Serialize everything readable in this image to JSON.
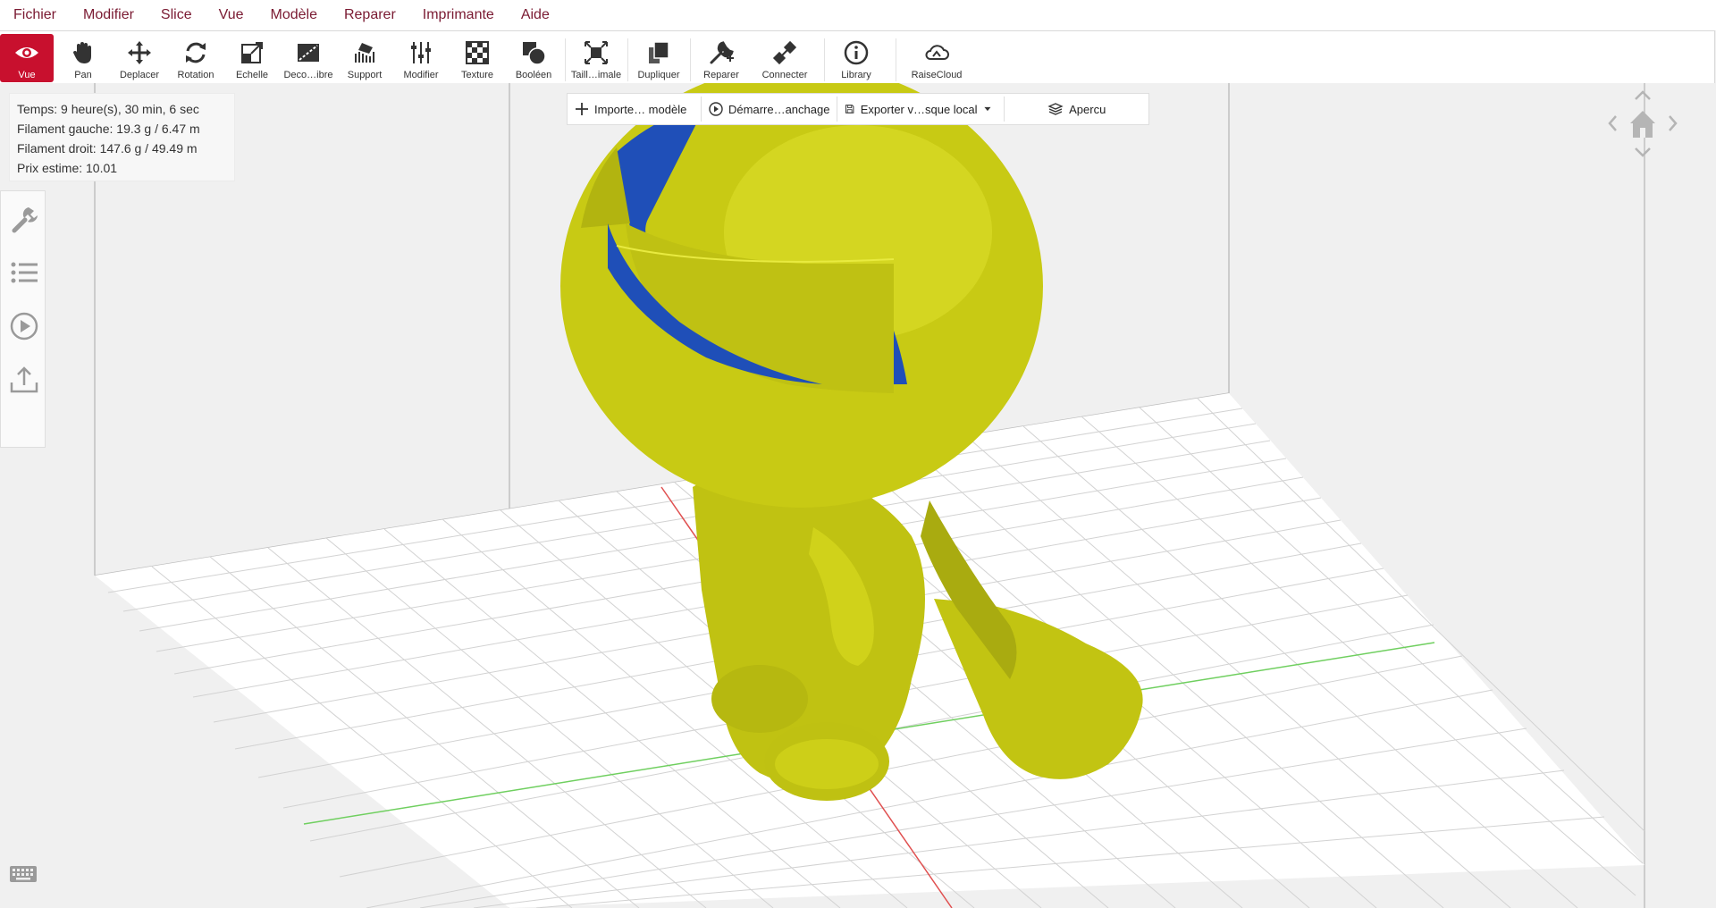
{
  "menu": [
    "Fichier",
    "Modifier",
    "Slice",
    "Vue",
    "Modèle",
    "Reparer",
    "Imprimante",
    "Aide"
  ],
  "toolbar": {
    "vue": "Vue",
    "pan": "Pan",
    "deplacer": "Deplacer",
    "rotation": "Rotation",
    "echelle": "Echelle",
    "decoupe": "Deco…ibre",
    "support": "Support",
    "modifier": "Modifier",
    "texture": "Texture",
    "booleen": "Booléen",
    "taille": "Taill…imale",
    "dupliquer": "Dupliquer",
    "reparer": "Reparer",
    "connecter": "Connecter",
    "library": "Library",
    "raisecloud": "RaiseCloud"
  },
  "stats": {
    "temps": "Temps: 9 heure(s), 30 min, 6 sec",
    "filament_gauche": "Filament gauche: 19.3 g / 6.47 m",
    "filament_droit": "Filament droit: 147.6 g / 49.49 m",
    "prix": "Prix estime: 10.01"
  },
  "actions": {
    "importer": "Importe… modèle",
    "demarrer": "Démarre…anchage",
    "exporter": "Exporter v…sque local",
    "apercu": "Apercu"
  },
  "colors": {
    "accent": "#c8102e",
    "menu_text": "#7a1a32",
    "model_yellow": "#c8cc14",
    "model_blue": "#1f4fb8"
  },
  "icons": [
    "eye-icon",
    "hand-icon",
    "move-icon",
    "rotate-icon",
    "scale-icon",
    "cut-icon",
    "support-icon",
    "sliders-icon",
    "texture-icon",
    "boolean-icon",
    "fit-icon",
    "duplicate-icon",
    "repair-icon",
    "connect-icon",
    "info-icon",
    "cloud-icon",
    "wrench-icon",
    "list-icon",
    "play-icon",
    "upload-icon",
    "home-icon",
    "keyboard-icon"
  ]
}
